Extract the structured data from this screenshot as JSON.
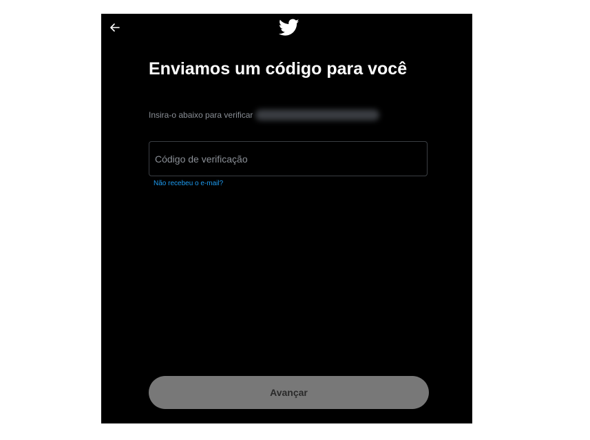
{
  "header": {
    "back_icon": "arrow-left-icon",
    "logo_icon": "twitter-bird-icon",
    "brand_color": "#ffffff"
  },
  "main": {
    "title": "Enviamos um código para você",
    "subtitle": "Insira-o abaixo para verificar",
    "code_input": {
      "placeholder": "Código de verificação",
      "value": ""
    },
    "resend_link": "Não recebeu o e-mail?",
    "link_color": "#1d9bf0"
  },
  "footer": {
    "next_button_label": "Avançar",
    "next_button_color": "#787878"
  }
}
